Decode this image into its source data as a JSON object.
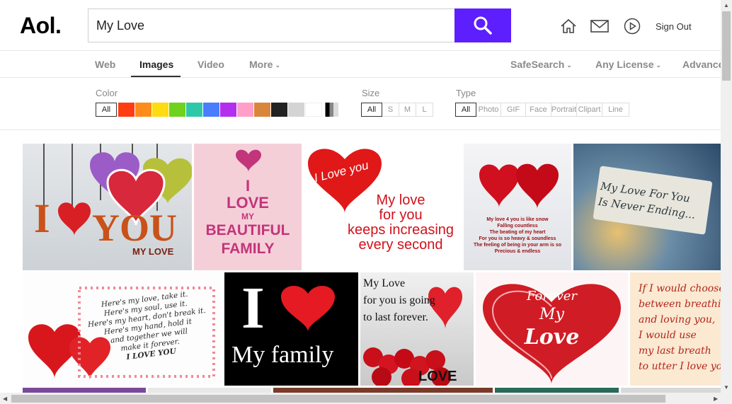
{
  "header": {
    "logo": "Aol.",
    "search_value": "My Love",
    "sign_out": "Sign Out",
    "icons": [
      "home-icon",
      "mail-icon",
      "play-icon"
    ]
  },
  "tabs": [
    {
      "label": "Web"
    },
    {
      "label": "Images",
      "active": true
    },
    {
      "label": "Video"
    },
    {
      "label": "More"
    },
    {
      "label": "SafeSearch"
    },
    {
      "label": "Any License"
    },
    {
      "label": "Advanced"
    }
  ],
  "filters": {
    "color_label": "Color",
    "color_all": "All",
    "colors": [
      "#ff3c12",
      "#ff8c1a",
      "#ffdb12",
      "#6fd21c",
      "#2dc8a8",
      "#4a7cff",
      "#b42ef0",
      "#ff9ec8",
      "#d9863a",
      "#222222",
      "#d4d4d4",
      "#ffffff"
    ],
    "size_label": "Size",
    "sizes": [
      "All",
      "S",
      "M",
      "L"
    ],
    "type_label": "Type",
    "types": [
      "All",
      "Photo",
      "GIF",
      "Face",
      "Portrait",
      "Clipart",
      "Line"
    ]
  },
  "images": {
    "row1": [
      {
        "text_main": "I",
        "text_big": "YOU",
        "text_small": "MY LOVE"
      },
      {
        "line1": "I",
        "line2": "LOVE",
        "line3": "MY",
        "line4": "BEAUTIFUL",
        "line5": "FAMILY"
      },
      {
        "heart_text": "I Love you",
        "line1": "My love",
        "line2": "for you",
        "line3": "keeps increasing",
        "line4": "every second"
      },
      {
        "l1": "My love 4 you is like snow",
        "l2": "Falling countless",
        "l3": "The beating of my heart",
        "l4": "For you is so heavy & soundless",
        "l5": "The feeling of being in your arm is so",
        "l6": "Precious & endless"
      },
      {
        "line1": "My Love For You",
        "line2": "Is Never Ending..."
      }
    ],
    "row2": [
      {
        "l1": "Here's my love, take it.",
        "l2": "Here's my soul, use it.",
        "l3": "Here's my heart, don't break it.",
        "l4": "Here's my hand, hold it",
        "l5": "and together we will",
        "l6": "make it forever.",
        "l7": "I LOVE YOU"
      },
      {
        "big": "I",
        "bottom": "My family"
      },
      {
        "l1": "My Love",
        "l2": "for you is going",
        "l3": "to last forever.",
        "love": "LOVE"
      },
      {
        "l1": "Forever",
        "l2": "My",
        "l3": "Love"
      },
      {
        "l1": "If I would choose",
        "l2": "between breathing",
        "l3": "and loving you,",
        "l4": "I would use",
        "l5": "my last breath",
        "l6": "to utter I love you"
      }
    ]
  }
}
